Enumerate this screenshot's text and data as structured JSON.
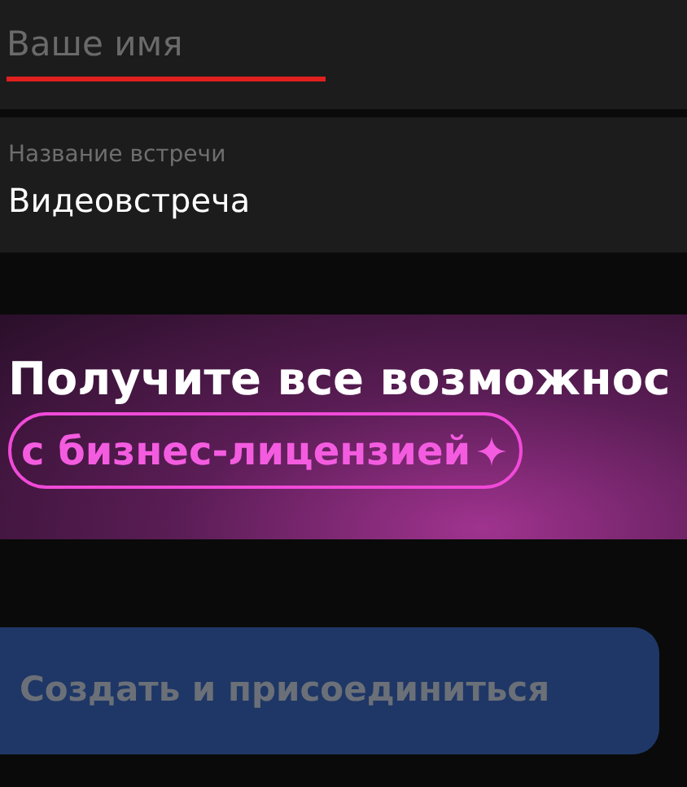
{
  "name_field": {
    "placeholder": "Ваше имя",
    "invalid": true
  },
  "meeting_field": {
    "label": "Название встречи",
    "value": "Видеовстреча"
  },
  "promo_banner": {
    "title": "Получите все возможнос",
    "pill": "с бизнес-лицензией"
  },
  "create_button": {
    "label": "Создать и присоединиться",
    "disabled": true
  }
}
